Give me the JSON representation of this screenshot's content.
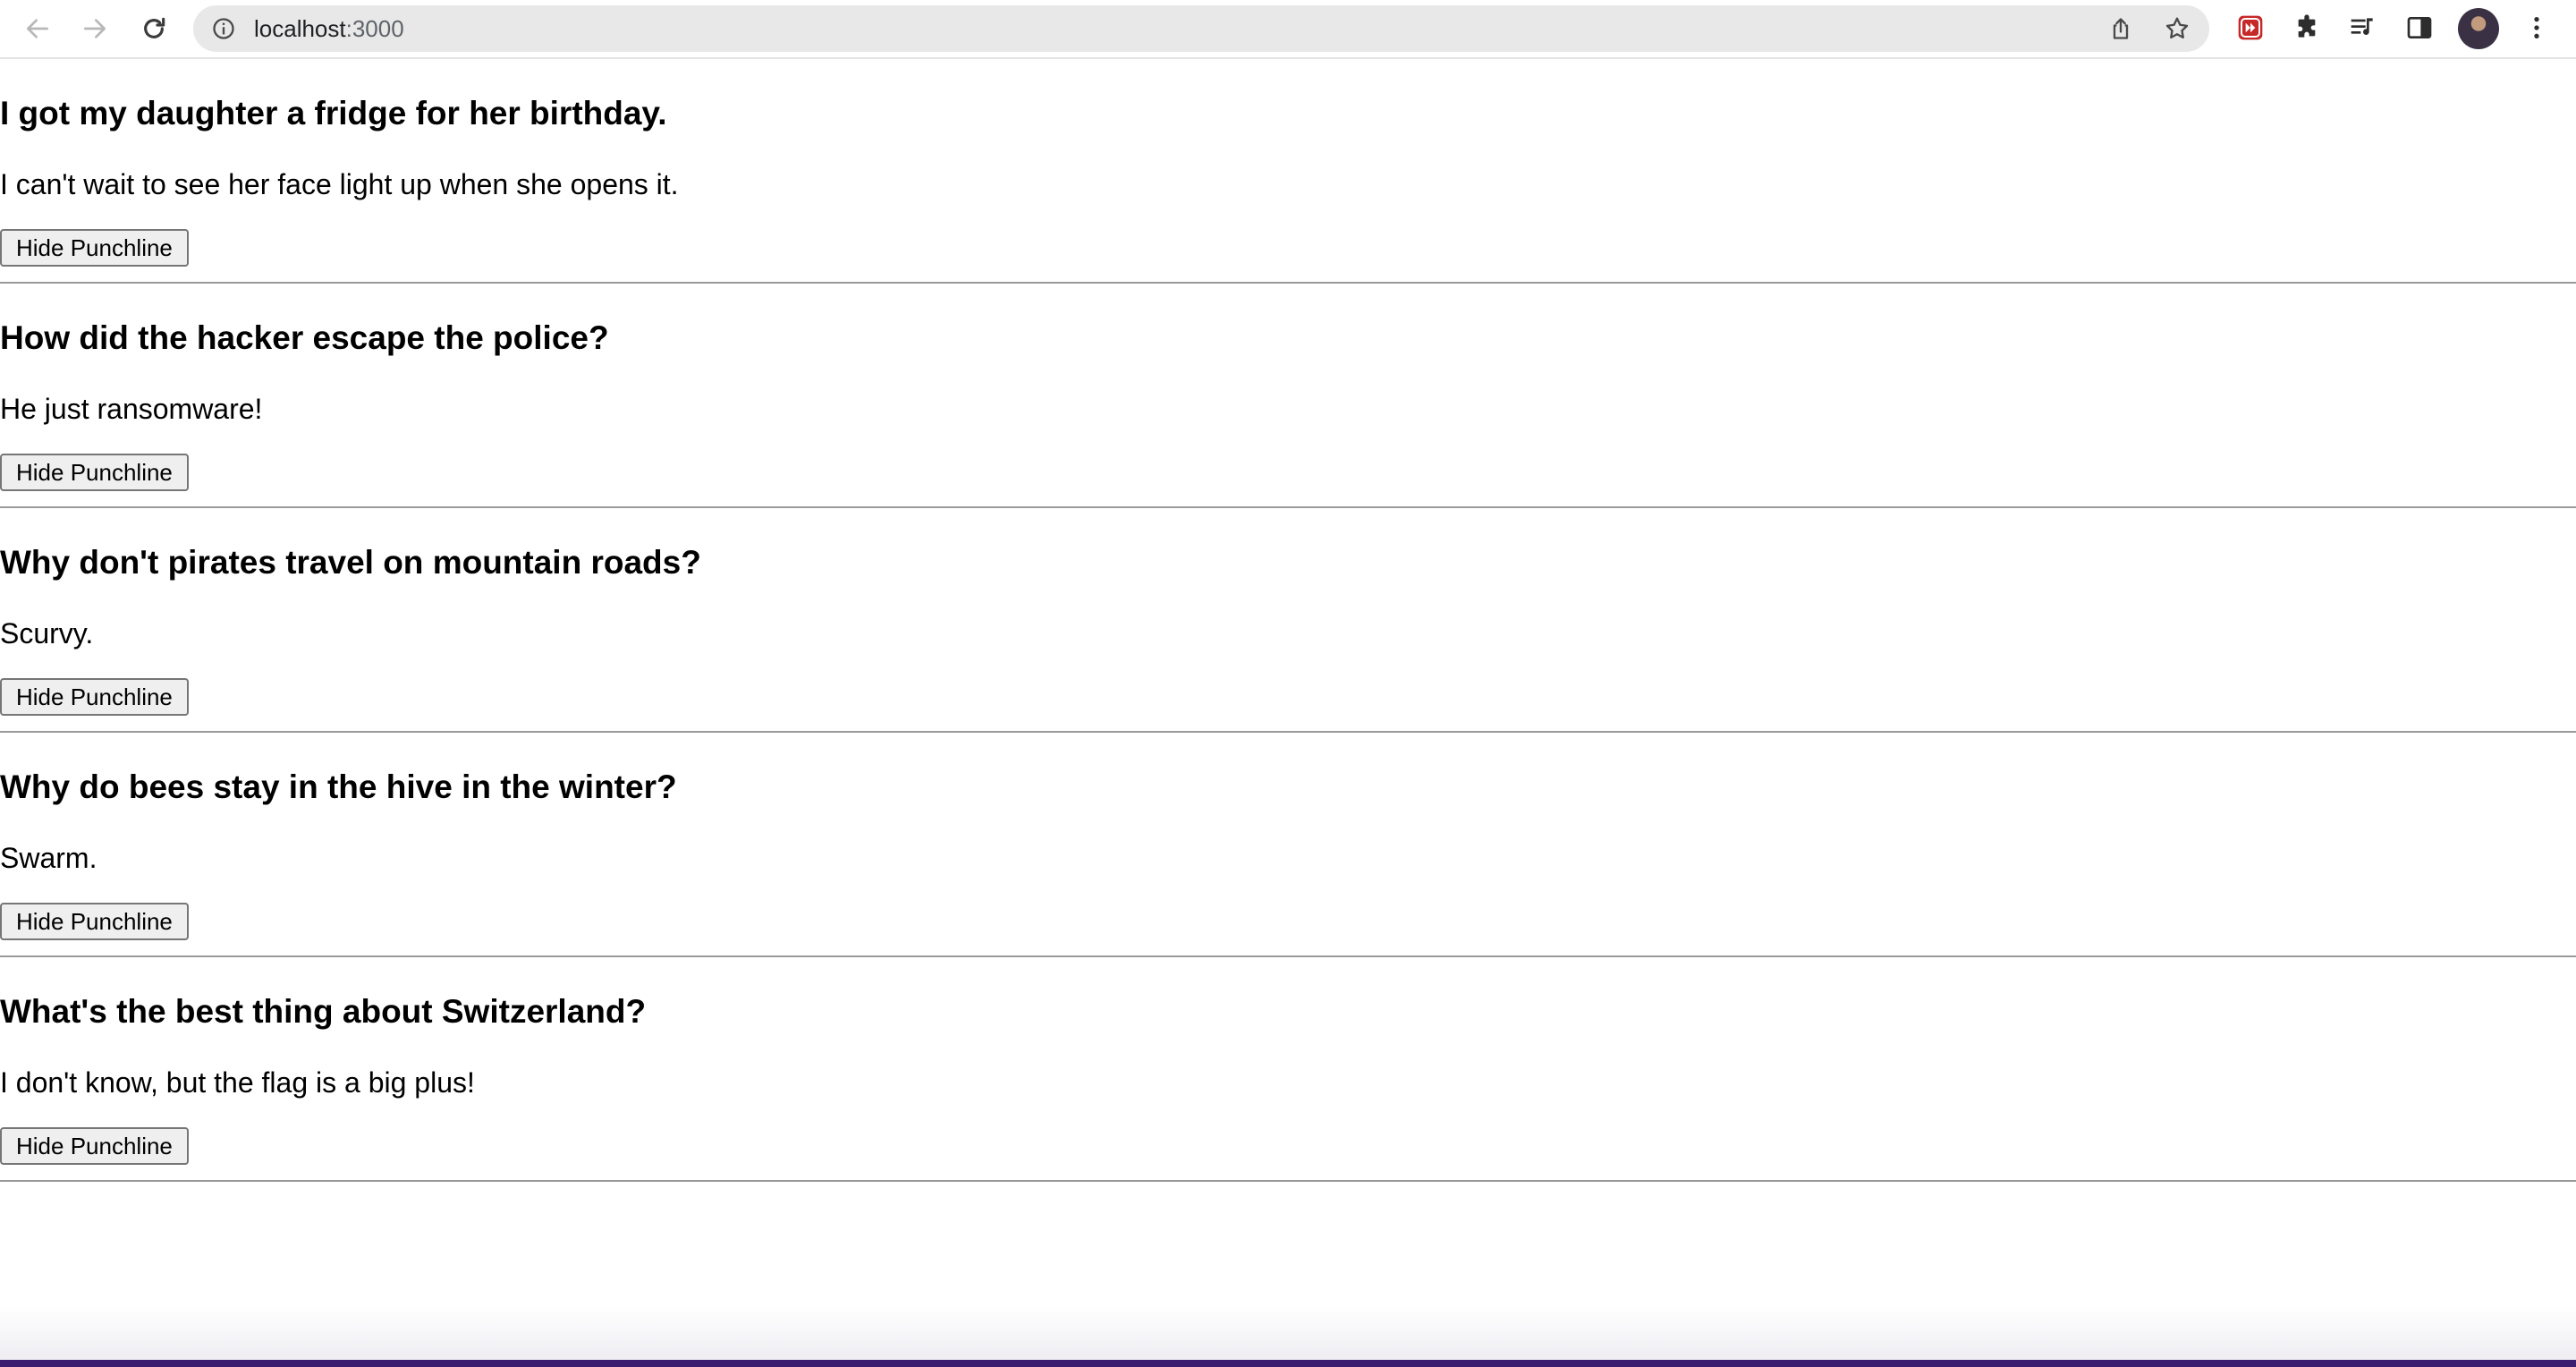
{
  "browser": {
    "url_host": "localhost",
    "url_port": ":3000",
    "icons": {
      "back": "back-arrow-icon",
      "forward": "forward-arrow-icon",
      "reload": "reload-icon",
      "info": "info-icon",
      "share": "share-icon",
      "bookmark": "star-icon",
      "extension_red": "red-extension-icon",
      "extensions": "puzzle-icon",
      "media": "media-playlist-icon",
      "side_panel": "side-panel-icon",
      "profile": "avatar",
      "menu": "kebab-menu-icon"
    }
  },
  "jokes": [
    {
      "setup": "I got my daughter a fridge for her birthday.",
      "punchline": "I can't wait to see her face light up when she opens it.",
      "button_label": "Hide Punchline"
    },
    {
      "setup": "How did the hacker escape the police?",
      "punchline": "He just ransomware!",
      "button_label": "Hide Punchline"
    },
    {
      "setup": "Why don't pirates travel on mountain roads?",
      "punchline": "Scurvy.",
      "button_label": "Hide Punchline"
    },
    {
      "setup": "Why do bees stay in the hive in the winter?",
      "punchline": "Swarm.",
      "button_label": "Hide Punchline"
    },
    {
      "setup": "What's the best thing about Switzerland?",
      "punchline": "I don't know, but the flag is a big plus!",
      "button_label": "Hide Punchline"
    }
  ]
}
